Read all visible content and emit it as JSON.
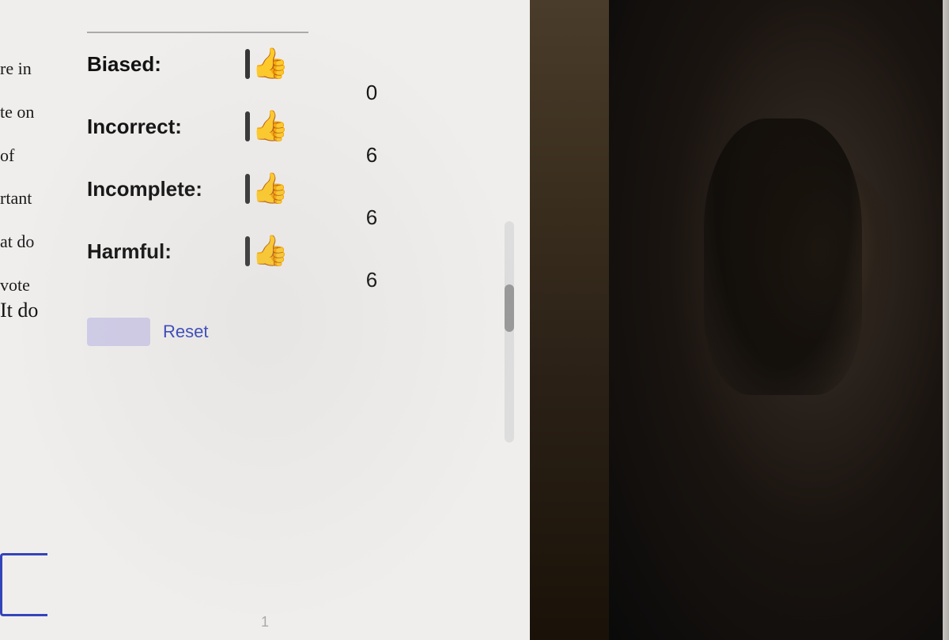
{
  "screen": {
    "top_divider": true,
    "sidebar_items": [
      {
        "text": "re in"
      },
      {
        "text": "te on"
      },
      {
        "text": "of"
      },
      {
        "text": "rtant"
      },
      {
        "text": "at do"
      },
      {
        "text": "vote"
      }
    ],
    "it_do_text": "It do",
    "ratings": [
      {
        "label": "Biased:",
        "count": "0",
        "id": "biased"
      },
      {
        "label": "Incorrect:",
        "count": "6",
        "id": "incorrect"
      },
      {
        "label": "Incomplete:",
        "count": "6",
        "id": "incomplete"
      },
      {
        "label": "Harmful:",
        "count": "6",
        "id": "harmful"
      }
    ],
    "reset_button": {
      "label": "Reset"
    },
    "scrollbar": true,
    "footer_number": "1"
  },
  "colors": {
    "thumb_blue": "#3344cc",
    "label_color": "#111111",
    "reset_color": "#3344bb",
    "bg_color": "#f0eeec"
  }
}
